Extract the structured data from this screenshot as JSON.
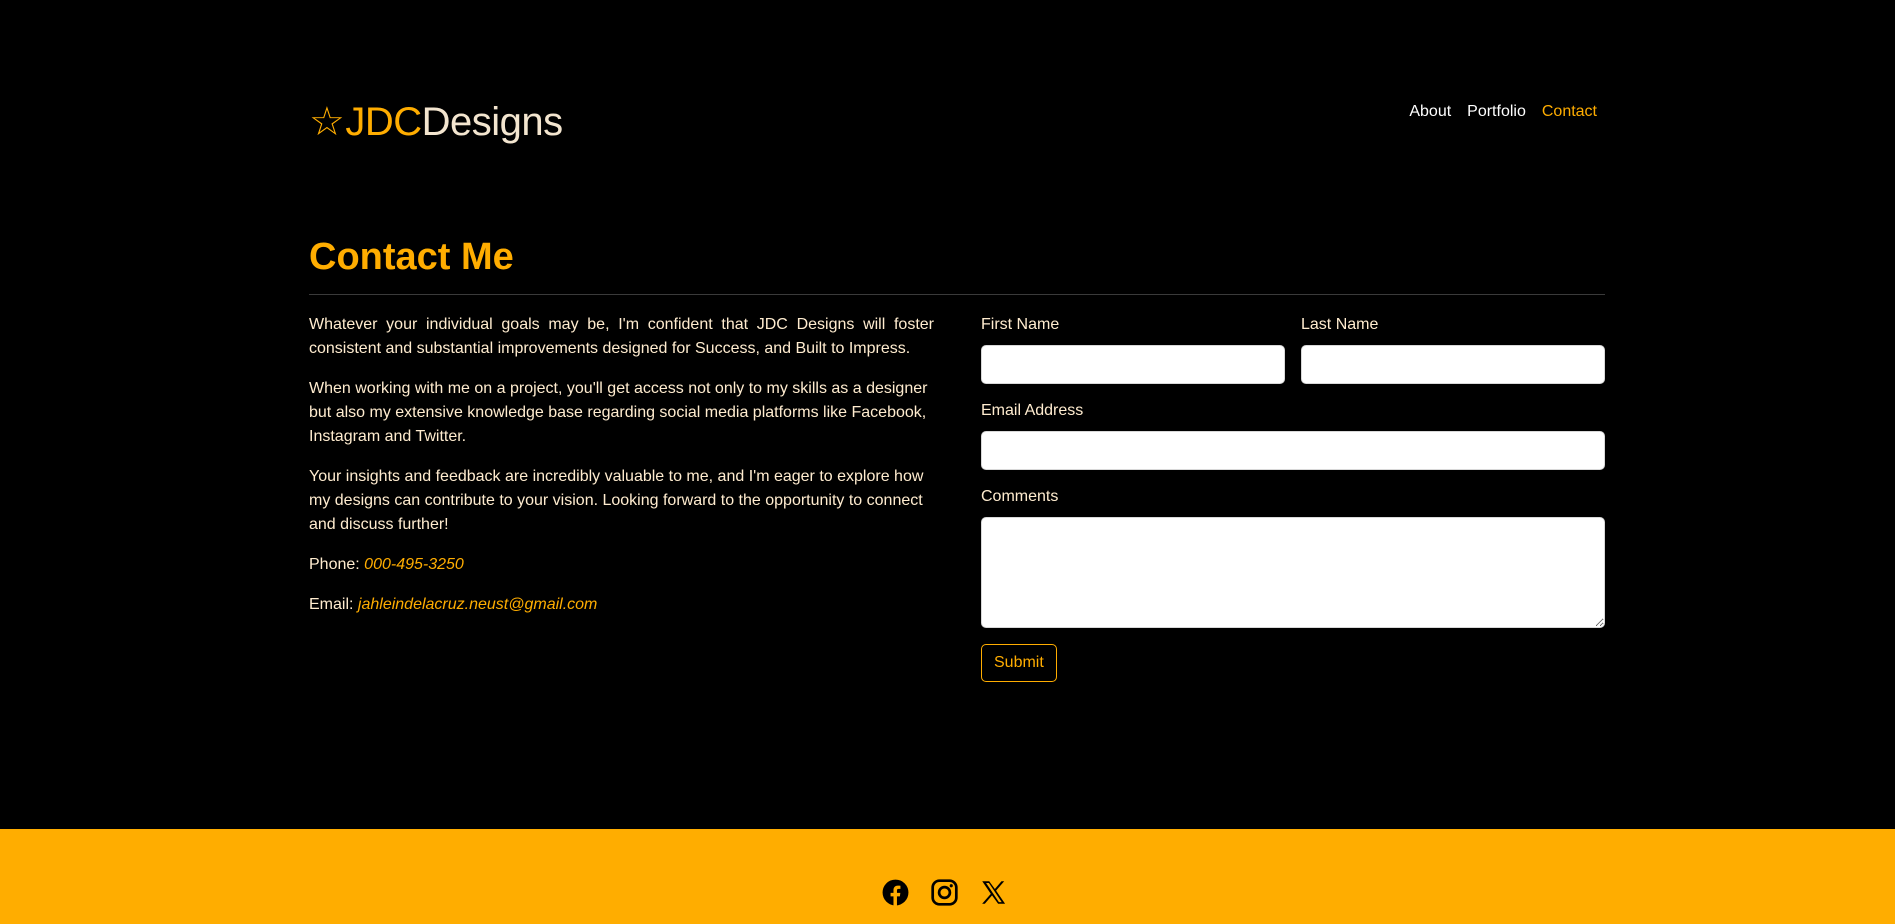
{
  "header": {
    "logo": {
      "star": "☆",
      "brand_accent": "JDC",
      "brand_rest": "Designs"
    },
    "nav": [
      {
        "label": "About",
        "active": false
      },
      {
        "label": "Portfolio",
        "active": false
      },
      {
        "label": "Contact",
        "active": true
      }
    ]
  },
  "main": {
    "title": "Contact Me",
    "paragraphs": [
      "Whatever your individual goals may be, I'm confident that JDC Designs will foster consistent and substantial improvements designed for Success, and Built to Impress.",
      "When working with me on a project, you'll get access not only to my skills as a designer but also my extensive knowledge base regarding social media platforms like Facebook, Instagram and Twitter.",
      "Your insights and feedback are incredibly valuable to me, and I'm eager to explore how my designs can contribute to your vision. Looking forward to the opportunity to connect and discuss further!"
    ],
    "phone": {
      "label": "Phone:",
      "value": "000-495-3250"
    },
    "email": {
      "label": "Email:",
      "value": "jahleindelacruz.neust@gmail.com"
    }
  },
  "form": {
    "first_name": {
      "label": "First Name",
      "value": ""
    },
    "last_name": {
      "label": "Last Name",
      "value": ""
    },
    "email": {
      "label": "Email Address",
      "value": ""
    },
    "comments": {
      "label": "Comments",
      "value": ""
    },
    "submit_label": "Submit"
  },
  "footer": {
    "social": [
      {
        "icon": "facebook-icon"
      },
      {
        "icon": "instagram-icon"
      },
      {
        "icon": "x-twitter-icon"
      }
    ]
  },
  "colors": {
    "background": "#000000",
    "accent": "#ffad00",
    "body_text": "#ffeccf",
    "nav_text": "#ffffff",
    "footer_bg": "#ffad00"
  }
}
